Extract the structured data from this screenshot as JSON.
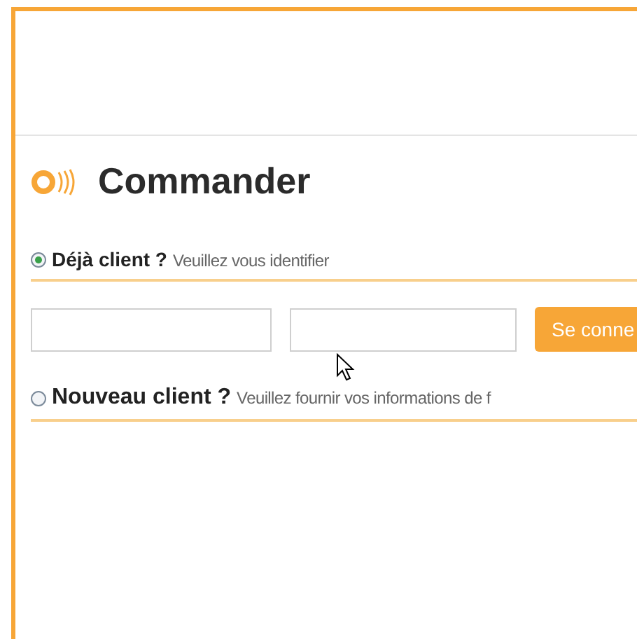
{
  "page": {
    "title": "Commander"
  },
  "sections": [
    {
      "heading": "Déjà client ?",
      "hint": "Veuillez vous identifier",
      "selected": true,
      "fields": [
        {
          "kind": "input"
        },
        {
          "kind": "input"
        }
      ],
      "button": "Se conne"
    },
    {
      "heading": "Nouveau client ?",
      "hint": "Veuillez fournir vos informations de f",
      "selected": false
    }
  ]
}
